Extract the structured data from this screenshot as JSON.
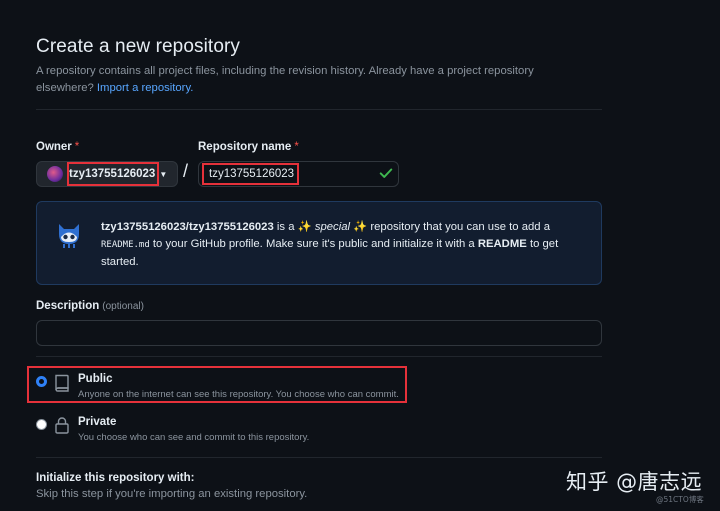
{
  "header": {
    "title": "Create a new repository",
    "subtitle": "A repository contains all project files, including the revision history. Already have a project repository elsewhere?",
    "import_link": "Import a repository."
  },
  "owner": {
    "label": "Owner",
    "required_mark": "*",
    "selected": "tzy13755126023"
  },
  "repo_name": {
    "label": "Repository name",
    "required_mark": "*",
    "value": "tzy13755126023",
    "separator": "/"
  },
  "info_box": {
    "repo_path": "tzy13755126023/tzy13755126023",
    "is_a": "is a",
    "sparkle": "✨",
    "special": "special",
    "part1": "repository that you can use to add a",
    "readme_file": "README.md",
    "part2": "to your GitHub profile. Make sure it's public and initialize it with a",
    "readme_bold": "README",
    "part3": "to get started."
  },
  "description": {
    "label": "Description",
    "optional": "(optional)",
    "value": ""
  },
  "visibility": {
    "public": {
      "title": "Public",
      "desc": "Anyone on the internet can see this repository. You choose who can commit.",
      "selected": true
    },
    "private": {
      "title": "Private",
      "desc": "You choose who can see and commit to this repository.",
      "selected": false
    }
  },
  "initialize": {
    "title": "Initialize this repository with:",
    "desc": "Skip this step if you're importing an existing repository."
  },
  "watermark": {
    "main": "知乎 @唐志远",
    "small": "@51CTO博客"
  },
  "colors": {
    "background": "#0d1117",
    "highlight": "#e5313a",
    "accent": "#2f81f7",
    "success": "#3fb950"
  }
}
